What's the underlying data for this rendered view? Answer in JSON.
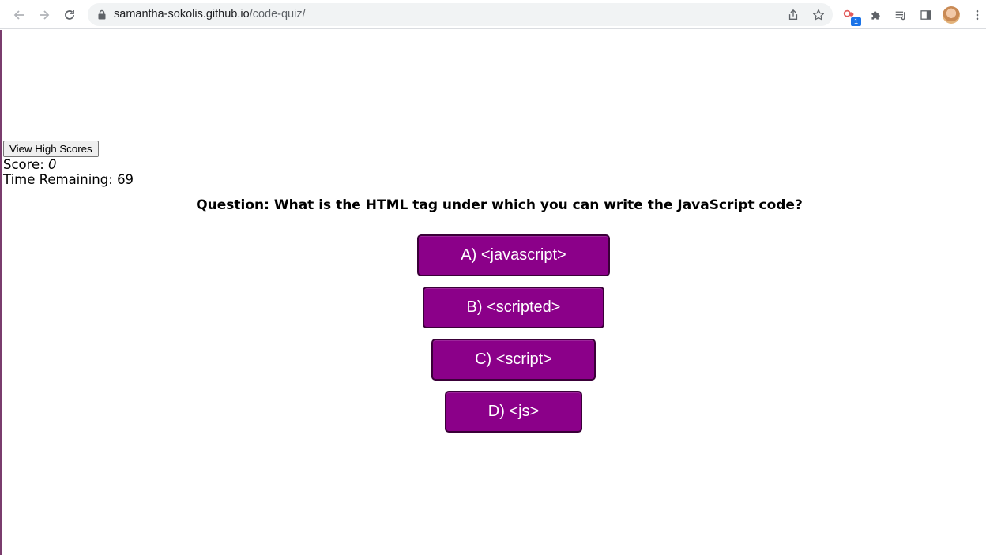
{
  "browser": {
    "url_host": "samantha-sokolis.github.io",
    "url_path": "/code-quiz/",
    "extension_badge": "1",
    "icons": [
      "back-arrow-icon",
      "forward-arrow-icon",
      "reload-icon",
      "lock-icon",
      "share-icon",
      "star-icon",
      "extension-icon",
      "puzzle-icon",
      "reading-list-icon",
      "side-panel-icon",
      "avatar",
      "more-menu-icon"
    ]
  },
  "quiz": {
    "high_scores_label": "View High Scores",
    "score_label": "Score:",
    "score_value": "0",
    "timer_label": "Time Remaining:",
    "timer_value": "69",
    "question": "Question: What is the HTML tag under which you can write the JavaScript code?",
    "answers": [
      "A) <javascript>",
      "B) <scripted>",
      "C) <script>",
      "D) <js>"
    ]
  },
  "colors": {
    "answer_bg": "#8b0089",
    "answer_border": "#3a0038",
    "answer_text": "#ffffff"
  }
}
